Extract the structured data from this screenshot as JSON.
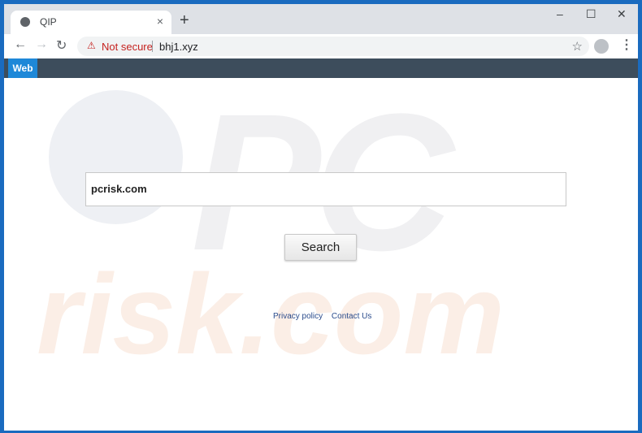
{
  "browser": {
    "tab": {
      "title": "QIP",
      "close_glyph": "×",
      "icon": "globe-icon"
    },
    "new_tab_glyph": "+",
    "window_controls": {
      "minimize": "–",
      "maximize": "☐",
      "close": "✕"
    },
    "nav": {
      "back": "←",
      "forward": "→",
      "reload": "↻"
    },
    "address_bar": {
      "security_icon": "⚠",
      "security_label": "Not secure",
      "url": "bhj1.xyz"
    },
    "bookmark_glyph": "☆",
    "menu_glyph": "⋮"
  },
  "page": {
    "nav_tab": "Web",
    "search": {
      "value": "pcrisk.com",
      "button_label": "Search"
    },
    "footer_links": [
      "Privacy policy",
      "Contact Us"
    ],
    "watermark": {
      "top": "PC",
      "bottom": "risk.com"
    }
  }
}
